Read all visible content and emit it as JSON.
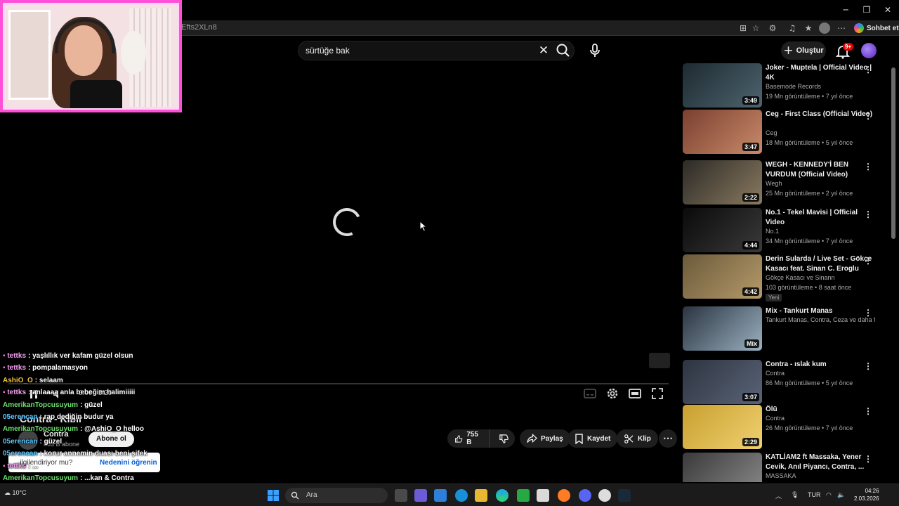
{
  "browser": {
    "url_fragment": "Efts2XLn8",
    "copilot_label": "Sohbet et"
  },
  "header": {
    "search_value": "sürtüğe bak",
    "create_label": "Oluştur",
    "notification_count": "9+"
  },
  "player": {
    "time": "0:00 / 3:20",
    "state": "loading"
  },
  "video": {
    "title": "Contra - Kibir",
    "channel": "Contra",
    "subscribers": "863 B abone",
    "subscribe_label": "Abone ol",
    "likes": "755 B",
    "share_label": "Paylaş",
    "save_label": "Kaydet",
    "clip_label": "Klip"
  },
  "notice": {
    "question": "...ilgilendiriyor mu?",
    "learn_label": "Nedenini öğrenin"
  },
  "chat": [
    {
      "user": "tettks",
      "msg": ": yaşlıllık ver kafam güzel olsun",
      "color": "u1"
    },
    {
      "user": "tettks",
      "msg": ": pompalamasyon",
      "color": "u1"
    },
    {
      "user": "AshiO_O",
      "msg": ": selaam",
      "color": "u3"
    },
    {
      "user": "tettks",
      "msg": ": anlaaaa anla bebeğim halimiiiii",
      "color": "u1"
    },
    {
      "user": "AmerikanTopcusuyum",
      "msg": ": güzel",
      "color": "u2"
    },
    {
      "user": "05erencan",
      "msg": ": rap dediğin budur ya",
      "color": "u4"
    },
    {
      "user": "AmerikanTopcusuyum",
      "msg": ": @AshiO_O helloo",
      "color": "u2"
    },
    {
      "user": "05erencan",
      "msg": ": güzel",
      "color": "u4"
    },
    {
      "user": "05erencan",
      "msg": ": korur annemin duası beni şifek",
      "color": "u4"
    },
    {
      "user": "tettks",
      "msg": ": ...",
      "color": "u1"
    },
    {
      "user": "AmerikanTopcusuyum",
      "msg": ": ...kan & Contra",
      "color": "u2"
    },
    {
      "user": "tettks",
      "msg": ": ...",
      "color": "u1"
    },
    {
      "user": "05erencan",
      "msg": ": son parçasıda çok iyi",
      "color": "u4"
    }
  ],
  "recommendations": [
    {
      "title": "Joker - Muptela | Official Video | 4K",
      "channel": "Basemode Records",
      "meta": "19 Mn görüntüleme • 7 yıl önce",
      "duration": "3:49",
      "colors": [
        "#1e2a30",
        "#4d6470"
      ]
    },
    {
      "title": "Ceg - First Class (Official Video)",
      "channel": "Ceg",
      "meta": "18 Mn görüntüleme • 5 yıl önce",
      "duration": "3:47",
      "colors": [
        "#7a4030",
        "#c98a6a"
      ]
    },
    {
      "title": "WEGH - KENNEDY'İ BEN VURDUM (Official Video)",
      "channel": "Wegh",
      "meta": "25 Mn görüntüleme • 2 yıl önce",
      "duration": "2:22",
      "colors": [
        "#2c2a26",
        "#8a7a60"
      ]
    },
    {
      "title": "No.1 - Tekel Mavisi | Official Video",
      "channel": "No.1",
      "meta": "34 Mn görüntüleme • 7 yıl önce",
      "duration": "4:44",
      "colors": [
        "#0a0a0a",
        "#3a3a3a"
      ]
    },
    {
      "title": "Derin Sularda / Live Set - Gökçe Kasacı feat. Sinan C. Eroglu",
      "channel": "Gökçe Kasacı ve Sinann",
      "meta": "103 görüntüleme • 8 saat önce",
      "duration": "4:42",
      "badge": "Yeni",
      "colors": [
        "#6b5a3a",
        "#b59a6a"
      ]
    },
    {
      "title": "Mix - Tankurt Manas",
      "channel": "Tankurt Manas, Contra, Ceza ve daha faz...",
      "meta": "",
      "duration": "Mix",
      "colors": [
        "#2a3440",
        "#9ab0c0"
      ]
    },
    {
      "title": "Contra - ıslak kum",
      "channel": "Contra",
      "meta": "86 Mn görüntüleme • 5 yıl önce",
      "duration": "3:07",
      "colors": [
        "#2e3440",
        "#5a6478"
      ]
    },
    {
      "title": "Ölü",
      "channel": "Contra",
      "meta": "26 Mn görüntüleme • 7 yıl önce",
      "duration": "2:29",
      "colors": [
        "#c8a030",
        "#f0d070"
      ]
    },
    {
      "title": "KATLİAM2 ft Massaka, Yener Cevik, Anıl Piyancı, Contra, ...",
      "channel": "MASSAKA",
      "meta": "",
      "duration": "",
      "colors": [
        "#3a3a3a",
        "#8a8a8a"
      ]
    }
  ],
  "taskbar": {
    "search_placeholder": "Ara",
    "language": "TUR",
    "time": "04:26",
    "date": "2.03.2026",
    "weather": "10°C"
  }
}
